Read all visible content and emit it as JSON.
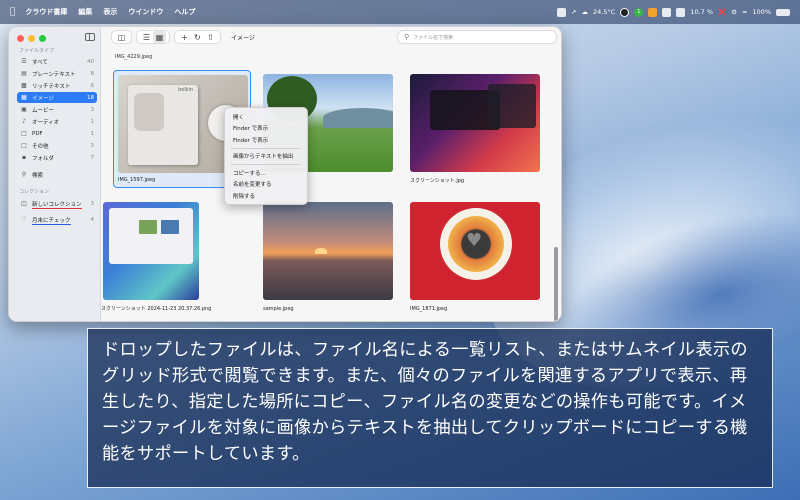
{
  "menubar": {
    "app_name": "クラウド書庫",
    "menus": [
      "編集",
      "表示",
      "ウインドウ",
      "ヘルプ"
    ],
    "weather": "24.5°C",
    "badge_text": "1",
    "cpu": "10.7 %",
    "battery": "100%"
  },
  "sidebar": {
    "section_file_type": "ファイルタイプ",
    "items": [
      {
        "label": "すべて",
        "count": "40",
        "icon": "stack-icon"
      },
      {
        "label": "プレーンテキスト",
        "count": "8",
        "icon": "text-doc-icon"
      },
      {
        "label": "リッチテキスト",
        "count": "6",
        "icon": "rich-text-icon"
      },
      {
        "label": "イメージ",
        "count": "18",
        "icon": "photo-icon"
      },
      {
        "label": "ムービー",
        "count": "3",
        "icon": "film-icon"
      },
      {
        "label": "オーディオ",
        "count": "1",
        "icon": "music-note-icon"
      },
      {
        "label": "PDF",
        "count": "1",
        "icon": "pdf-icon"
      },
      {
        "label": "その他",
        "count": "3",
        "icon": "other-icon"
      },
      {
        "label": "フォルダ",
        "count": "7",
        "icon": "folder-icon"
      }
    ],
    "search_label": "検索",
    "section_collection": "コレクション",
    "collections": [
      {
        "label": "新しいコレクション",
        "count": "3"
      },
      {
        "label": "月末にチェック",
        "count": "4"
      }
    ]
  },
  "toolbar": {
    "title": "イメージ",
    "search_placeholder": "ファイル名で検索"
  },
  "grid": {
    "top_file": "IMG_4229.jpeg",
    "files": [
      {
        "name": "IMG_1597.jpeg",
        "kind": "belkin"
      },
      {
        "name": "",
        "kind": "field"
      },
      {
        "name": "スクリーンショット.jpg",
        "kind": "screen1"
      },
      {
        "name": "スクリーンショット 2024-11-23 20.37.26.png",
        "kind": "screen2"
      },
      {
        "name": "sample.jpeg",
        "kind": "sunset"
      },
      {
        "name": "IMG_1871.jpeg",
        "kind": "cake"
      }
    ],
    "belkin_brand": "belkin"
  },
  "context_menu": {
    "items": [
      "開く",
      "Finder で表示",
      "Finder で表示",
      "画像からテキストを抽出",
      "コピーする...",
      "名前を変更する",
      "削除する"
    ]
  },
  "caption": {
    "text": "ドロップしたファイルは、ファイル名による一覧リスト、またはサムネイル表示のグリッド形式で閲覧できます。また、個々のファイルを関連するアプリで表示、再生したり、指定した場所にコピー、ファイル名の変更などの操作も可能です。イメージファイルを対象に画像からテキストを抽出してクリップボードにコピーする機能をサポートしています。"
  }
}
